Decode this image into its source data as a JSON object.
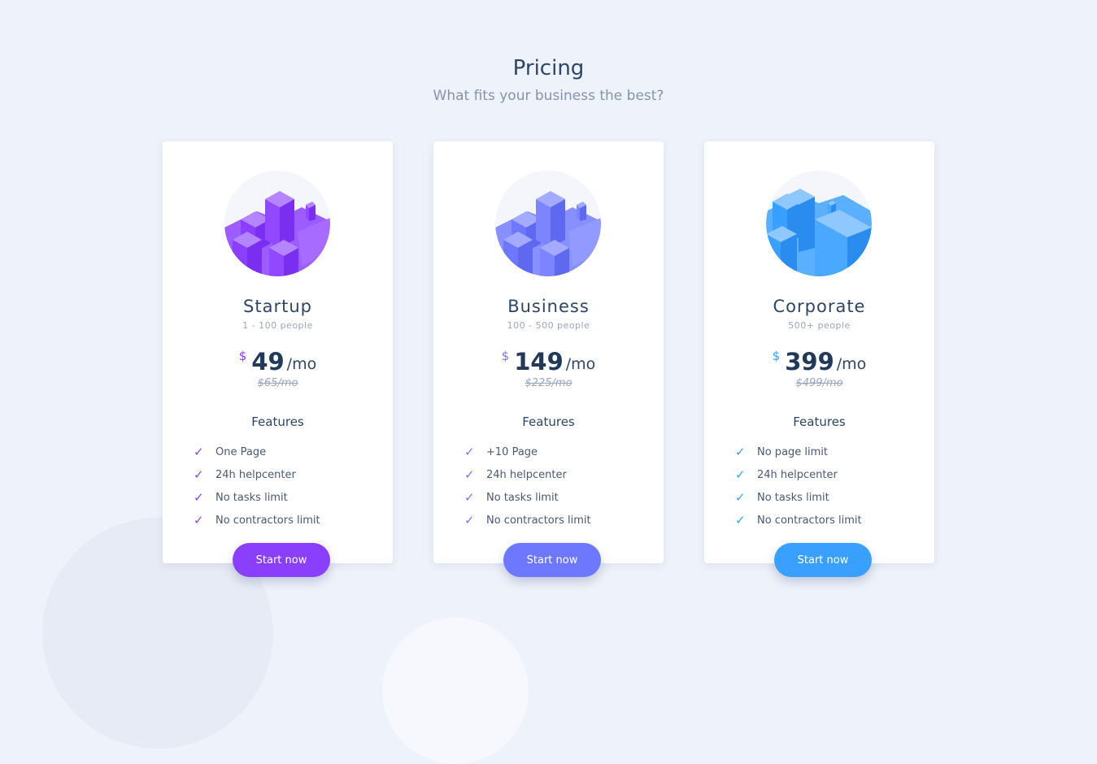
{
  "header": {
    "title": "Pricing",
    "subtitle": "What fits your business the best?"
  },
  "features_title": "Features",
  "plans": [
    {
      "name": "Startup",
      "people": "1 - 100 people",
      "currency": "$",
      "price": "49",
      "per": "/mo",
      "old_price": "$65/mo",
      "accent": "#8a3ffc",
      "features": [
        "One Page",
        "24h helpcenter",
        "No tasks limit",
        "No contractors limit"
      ],
      "button_label": "Start now"
    },
    {
      "name": "Business",
      "people": "100 - 500 people",
      "currency": "$",
      "price": "149",
      "per": "/mo",
      "old_price": "$225/mo",
      "accent": "#6e78ff",
      "features": [
        "+10 Page",
        "24h helpcenter",
        "No tasks limit",
        "No contractors limit"
      ],
      "button_label": "Start now"
    },
    {
      "name": "Corporate",
      "people": "500+ people",
      "currency": "$",
      "price": "399",
      "per": "/mo",
      "old_price": "$499/mo",
      "accent": "#3aa0ff",
      "features": [
        "No page limit",
        "24h helpcenter",
        "No tasks limit",
        "No contractors limit"
      ],
      "button_label": "Start now"
    }
  ],
  "icons": {
    "check": "check-icon",
    "illustration": "isometric-buildings-illustration"
  }
}
